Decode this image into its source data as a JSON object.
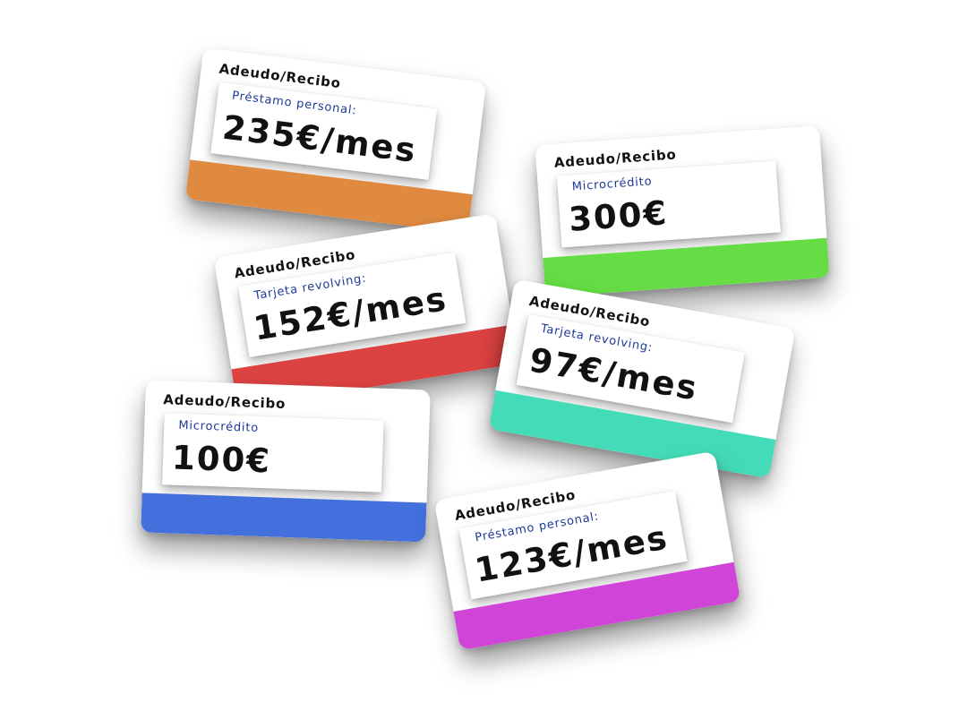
{
  "cards": [
    {
      "title": "Adeudo/Recibo",
      "subtitle": "Préstamo personal:",
      "amount": "235€/mes",
      "color": "#e08a40"
    },
    {
      "title": "Adeudo/Recibo",
      "subtitle": "Microcrédito",
      "amount": "300€",
      "color": "#66dd44"
    },
    {
      "title": "Adeudo/Recibo",
      "subtitle": "Tarjeta revolving:",
      "amount": "152€/mes",
      "color": "#dd4242"
    },
    {
      "title": "Adeudo/Recibo",
      "subtitle": "Tarjeta revolving:",
      "amount": "97€/mes",
      "color": "#44dcb8"
    },
    {
      "title": "Adeudo/Recibo",
      "subtitle": "Microcrédito",
      "amount": "100€",
      "color": "#4470dd"
    },
    {
      "title": "Adeudo/Recibo",
      "subtitle": "Préstamo personal:",
      "amount": "123€/mes",
      "color": "#d044d8"
    }
  ]
}
